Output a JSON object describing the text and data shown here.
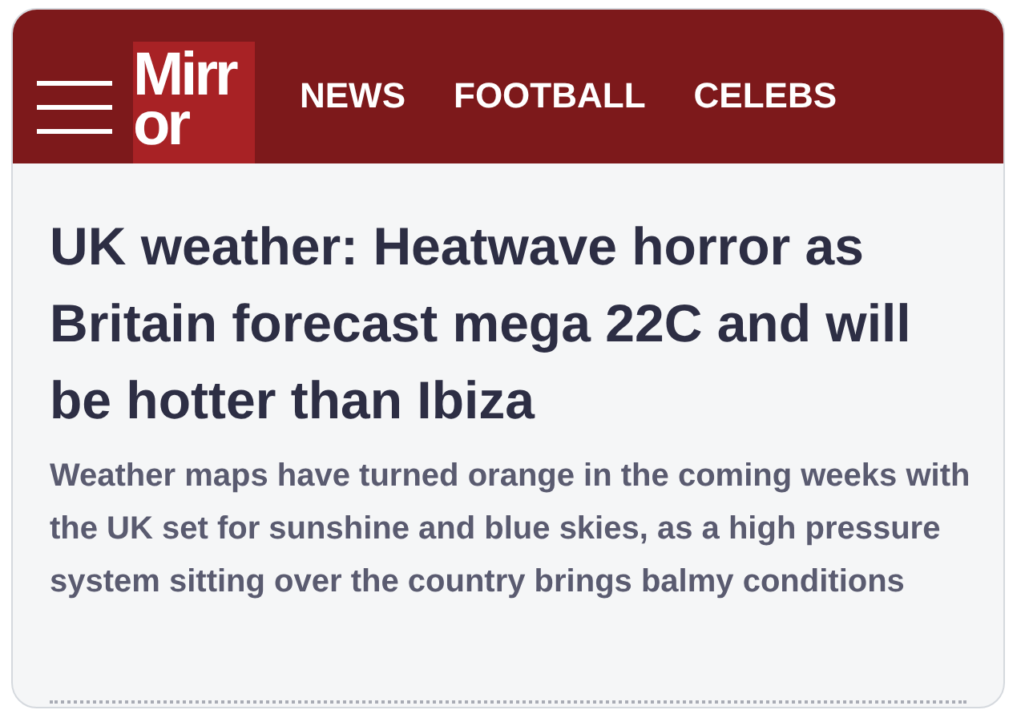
{
  "header": {
    "logo": {
      "lines": [
        "Mirr",
        "or"
      ]
    },
    "nav": [
      {
        "label": "NEWS"
      },
      {
        "label": "FOOTBALL"
      },
      {
        "label": "CELEBS"
      }
    ]
  },
  "article": {
    "headline": "UK weather: Heatwave horror as Britain forecast mega 22C and will be hotter than Ibiza",
    "summary": "Weather maps have turned orange in the coming weeks with the UK set for sunshine and blue skies, as a high pressure system sitting over the country brings balmy conditions"
  }
}
